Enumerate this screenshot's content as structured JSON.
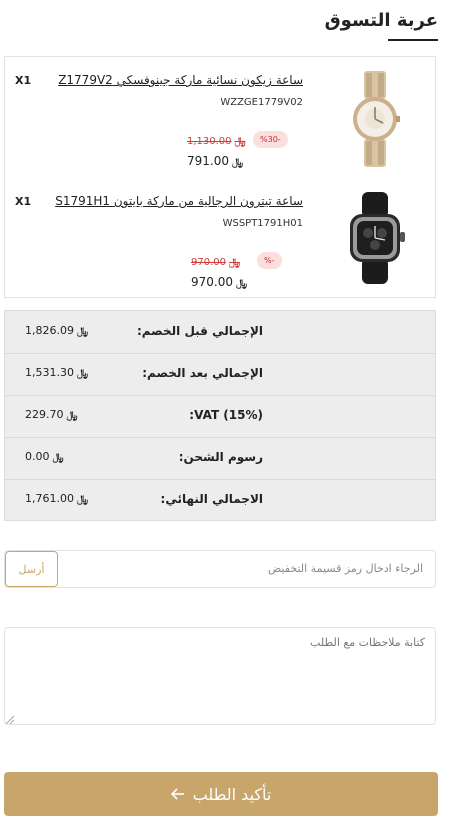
{
  "page": {
    "title": "عربة التسوق"
  },
  "cart": {
    "items": [
      {
        "qty": "X1",
        "name": "ساعة زيكون نسائية ماركة جينوفسكي Z1779V2",
        "sku": "WZZGE1779V02",
        "old_price": "1,130.00",
        "discount_badge": "%30-",
        "price": "791.00",
        "image_icon": "rose-gold-womens-watch-image"
      },
      {
        "qty": "X1",
        "name": "ساعة تيترون الرجالية من ماركة بايتون S1791H1",
        "sku": "WSSPT1791H01",
        "old_price": "970.00",
        "discount_badge": "%-",
        "price": "970.00",
        "image_icon": "black-mens-watch-image"
      }
    ],
    "currency": "﷼"
  },
  "totals": [
    {
      "label": "الإجمالي قبل الخصم:",
      "value": "1,826.09"
    },
    {
      "label": "الإجمالي بعد الخصم:",
      "value": "1,531.30"
    },
    {
      "label": "VAT (15%):",
      "value": "229.70"
    },
    {
      "label": "رسوم الشحن:",
      "value": "0.00"
    },
    {
      "label": "الاجمالي النهائي:",
      "value": "1,761.00"
    }
  ],
  "coupon": {
    "placeholder": "الرجاء ادخال رمز قسيمة التخفيض",
    "button_label": "أرسل"
  },
  "notes": {
    "placeholder": "كتابة ملاحظات مع الطلب"
  },
  "confirm": {
    "label": "تأكيد الطلب",
    "icon": "arrow-left-icon"
  },
  "colors": {
    "accent": "#c8a56a",
    "discount": "#d23b3b",
    "totals_bg": "#ededed"
  }
}
